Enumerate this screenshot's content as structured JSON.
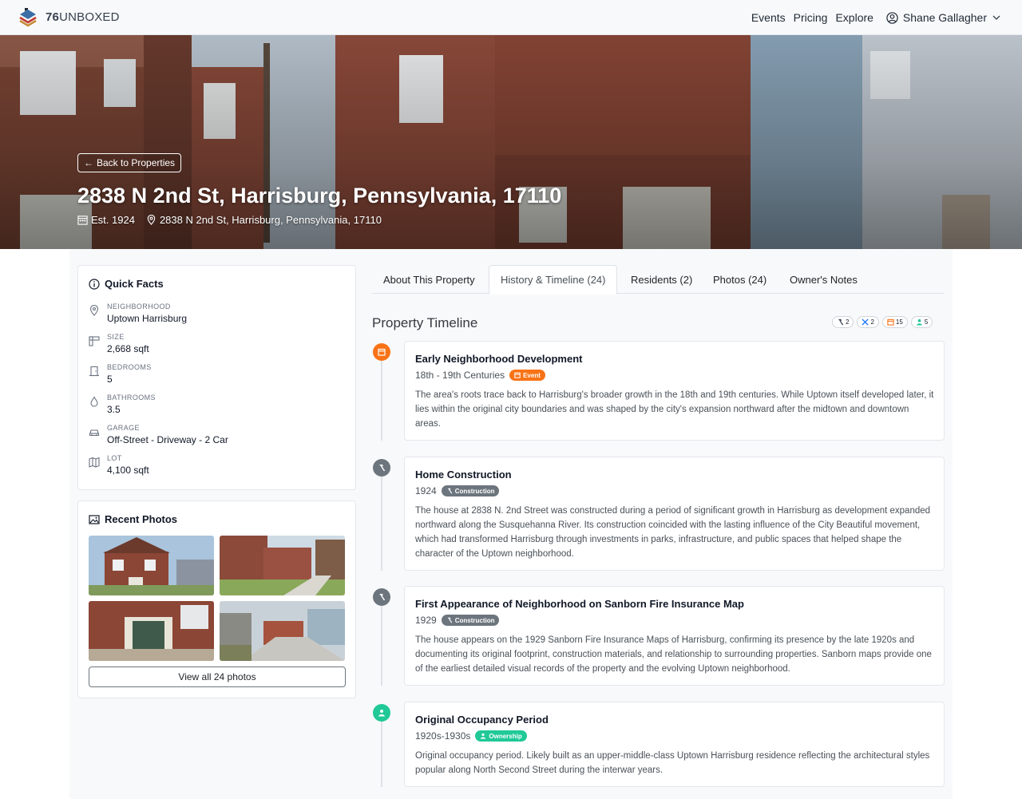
{
  "header": {
    "brand_num": "76",
    "brand_word": "UNBOXED",
    "nav": [
      "Events",
      "Pricing",
      "Explore"
    ],
    "user": "Shane Gallagher"
  },
  "hero": {
    "back_label": "Back to Properties",
    "title": "2838 N 2nd St, Harrisburg, Pennsylvania, 17110",
    "established": "Est. 1924",
    "address": "2838 N 2nd St, Harrisburg, Pennsylvania, 17110"
  },
  "quick_facts": {
    "title": "Quick Facts",
    "items": [
      {
        "label": "NEIGHBORHOOD",
        "value": "Uptown Harrisburg",
        "icon": "map-pin-icon"
      },
      {
        "label": "SIZE",
        "value": "2,668 sqft",
        "icon": "ruler-icon"
      },
      {
        "label": "BEDROOMS",
        "value": "5",
        "icon": "door-icon"
      },
      {
        "label": "BATHROOMS",
        "value": "3.5",
        "icon": "droplet-icon"
      },
      {
        "label": "GARAGE",
        "value": "Off-Street - Driveway - 2 Car",
        "icon": "car-icon"
      },
      {
        "label": "LOT",
        "value": "4,100 sqft",
        "icon": "map-icon"
      }
    ]
  },
  "recent_photos": {
    "title": "Recent Photos",
    "view_all": "View all 24 photos"
  },
  "tabs": [
    "About This Property",
    "History & Timeline (24)",
    "Residents (2)",
    "Photos (24)",
    "Owner's Notes"
  ],
  "active_tab": 1,
  "timeline": {
    "title": "Property Timeline",
    "counts": [
      {
        "icon": "hammer-icon",
        "value": "2",
        "color": "#374151"
      },
      {
        "icon": "tools-icon",
        "value": "2",
        "color": "#0d6efd"
      },
      {
        "icon": "calendar-icon",
        "value": "15",
        "color": "#f97316"
      },
      {
        "icon": "person-icon",
        "value": "5",
        "color": "#20c997"
      }
    ],
    "events": [
      {
        "title": "Early Neighborhood Development",
        "date": "18th - 19th Centuries",
        "badge": "Event",
        "badge_color": "#f97316",
        "icon": "calendar-icon",
        "text": "The area's roots trace back to Harrisburg's broader growth in the 18th and 19th centuries. While Uptown itself developed later, it lies within the original city boundaries and was shaped by the city's expansion northward after the midtown and downtown areas."
      },
      {
        "title": "Home Construction",
        "date": "1924",
        "badge": "Construction",
        "badge_color": "#6c757d",
        "icon": "hammer-icon",
        "text": "The house at 2838 N. 2nd Street was constructed during a period of significant growth in Harrisburg as development expanded northward along the Susquehanna River. Its construction coincided with the lasting influence of the City Beautiful movement, which had transformed Harrisburg through investments in parks, infrastructure, and public spaces that helped shape the character of the Uptown neighborhood."
      },
      {
        "title": "First Appearance of Neighborhood on Sanborn Fire Insurance Map",
        "date": "1929",
        "badge": "Construction",
        "badge_color": "#6c757d",
        "icon": "hammer-icon",
        "text": "The house appears on the 1929 Sanborn Fire Insurance Maps of Harrisburg, confirming its presence by the late 1920s and documenting its original footprint, construction materials, and relationship to surrounding properties. Sanborn maps provide one of the earliest detailed visual records of the property and the evolving Uptown neighborhood."
      },
      {
        "title": "Original Occupancy Period",
        "date": "1920s-1930s",
        "badge": "Ownership",
        "badge_color": "#20c997",
        "icon": "person-icon",
        "text": "Original occupancy period. Likely built as an upper-middle-class Uptown Harrisburg residence reflecting the architectural styles popular along North Second Street during the interwar years."
      }
    ]
  }
}
